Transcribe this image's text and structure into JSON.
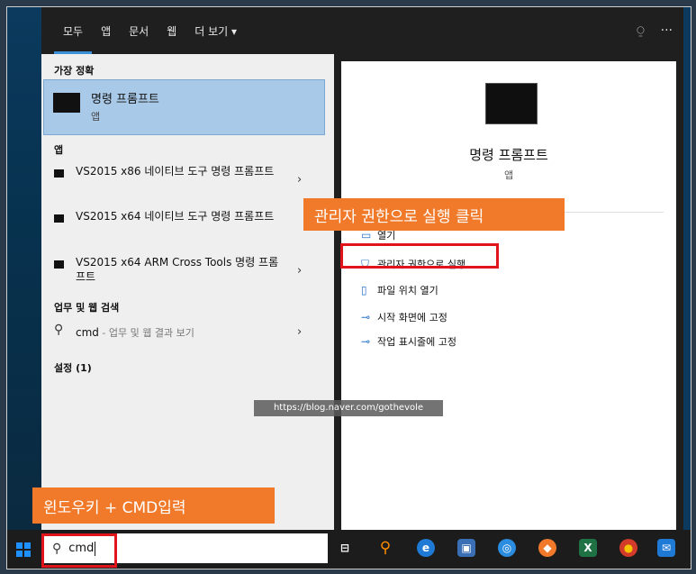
{
  "tabs": [
    "모두",
    "앱",
    "문서",
    "웹",
    "더 보기 ▾"
  ],
  "top_right": {
    "feedback_icon": "person-feedback-icon",
    "more": "···"
  },
  "left": {
    "best_match_title": "가장 정확",
    "best": {
      "name": "명령 프롬프트",
      "sub": "앱"
    },
    "apps_title": "앱",
    "apps": [
      {
        "name": "VS2015 x86 네이티브 도구 명령 프롬프트"
      },
      {
        "name": "VS2015 x64 네이티브 도구 명령 프롬프트"
      },
      {
        "name": "VS2015 x64 ARM Cross Tools 명령 프롬프트"
      }
    ],
    "web_title": "업무 및 웹 검색",
    "web": {
      "query": "cmd",
      "suffix": " - 업무 및 웹 결과 보기"
    },
    "settings_title": "설정 (1)",
    "chevron": "›"
  },
  "right": {
    "name": "명령 프롬프트",
    "sub": "앱",
    "actions": [
      {
        "icon": "open-icon",
        "glyph": "▭",
        "label": "열기"
      },
      {
        "icon": "run-as-admin-icon",
        "glyph": "⛉",
        "label": "관리자 권한으로 실행"
      },
      {
        "icon": "file-location-icon",
        "glyph": "▯",
        "label": "파일 위치 열기"
      },
      {
        "icon": "pin-start-icon",
        "glyph": "⊸",
        "label": "시작 화면에 고정"
      },
      {
        "icon": "pin-taskbar-icon",
        "glyph": "⊸",
        "label": "작업 표시줄에 고정"
      }
    ]
  },
  "callouts": {
    "admin": "관리자 권한으로 실행 클릭",
    "input": "윈도우키 + CMD입력"
  },
  "watermark": "https://blog.naver.com/gothevole",
  "taskbar": {
    "search_value": "cmd",
    "icons": [
      {
        "name": "task-view-icon",
        "glyph": "⊟",
        "color": "#ffffff",
        "bg": "transparent"
      },
      {
        "name": "search-app-icon",
        "glyph": "⚲",
        "color": "#ff8c00",
        "bg": "transparent"
      },
      {
        "name": "edge-icon",
        "glyph": "e",
        "color": "#ffffff",
        "bg": "#1f7ad6"
      },
      {
        "name": "store-icon",
        "glyph": "▣",
        "color": "#ffffff",
        "bg": "#3a6fb5"
      },
      {
        "name": "safari-like-icon",
        "glyph": "◎",
        "color": "#ffffff",
        "bg": "#2b8de0"
      },
      {
        "name": "brave-like-icon",
        "glyph": "◆",
        "color": "#ffffff",
        "bg": "#f07a2a"
      },
      {
        "name": "excel-icon",
        "glyph": "X",
        "color": "#ffffff",
        "bg": "#1f7244"
      },
      {
        "name": "chrome-icon",
        "glyph": "●",
        "color": "#f5c400",
        "bg": "#d23a2a"
      },
      {
        "name": "mail-icon",
        "glyph": "✉",
        "color": "#ffffff",
        "bg": "#1f7ad6"
      }
    ]
  }
}
